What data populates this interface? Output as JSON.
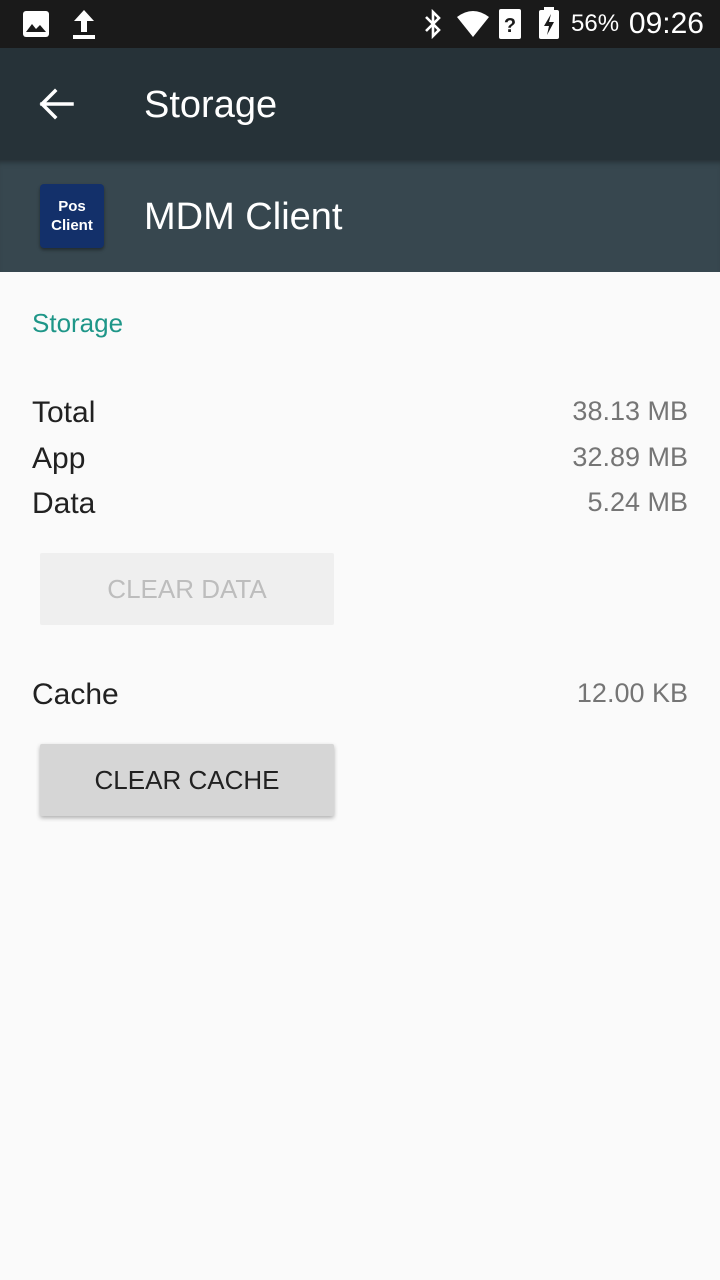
{
  "status_bar": {
    "icons_left": [
      "image-icon",
      "upload-icon"
    ],
    "icons_right": [
      "bluetooth-icon",
      "wifi-icon",
      "signal-unknown-icon",
      "battery-charging-icon"
    ],
    "battery": "56%",
    "time": "09:26"
  },
  "toolbar": {
    "back_icon": "arrow-back-icon",
    "title": "Storage"
  },
  "app": {
    "icon_line1": "Pos",
    "icon_line2": "Client",
    "name": "MDM Client"
  },
  "storage": {
    "section_title": "Storage",
    "rows": [
      {
        "label": "Total",
        "value": "38.13 MB"
      },
      {
        "label": "App",
        "value": "32.89 MB"
      },
      {
        "label": "Data",
        "value": "5.24 MB"
      }
    ],
    "clear_data_label": "CLEAR DATA",
    "cache_label": "Cache",
    "cache_value": "12.00 KB",
    "clear_cache_label": "CLEAR CACHE"
  },
  "colors": {
    "toolbar": "#263238",
    "app_header": "#37474f",
    "accent": "#1e9688"
  }
}
